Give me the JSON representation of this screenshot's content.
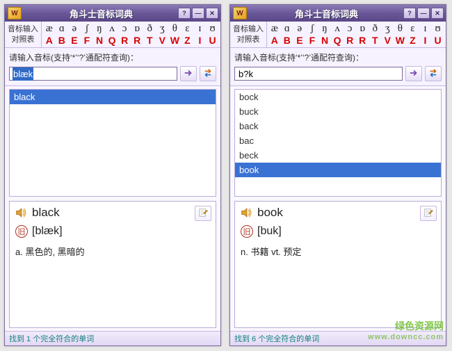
{
  "ipa_symbols": [
    "æ",
    "ɑ",
    "ə",
    "ʃ",
    "ŋ",
    "ʌ",
    "ɔ",
    "ɒ",
    "ð",
    "ʒ",
    "θ",
    "ɛ",
    "ɪ",
    "ʊ"
  ],
  "abc_letters": [
    "A",
    "B",
    "E",
    "F",
    "N",
    "Q",
    "R",
    "R",
    "T",
    "V",
    "W",
    "Z",
    "I",
    "U"
  ],
  "windows": [
    {
      "title": "角斗士音标词典",
      "ref_label1": "音标输入",
      "ref_label2": "对照表",
      "prompt": "请输入音标(支持‘*’‘?’通配符查询)：",
      "input_value": "blæk",
      "input_selected": true,
      "results": [
        "black"
      ],
      "selected_index": 0,
      "detail": {
        "word": "black",
        "badge": "旧",
        "pron": "[blæk]",
        "def": "a. 黑色的, 黑暗的"
      },
      "status": "找到 1 个完全符合的单词"
    },
    {
      "title": "角斗士音标词典",
      "ref_label1": "音标输入",
      "ref_label2": "对照表",
      "prompt": "请输入音标(支持‘*’‘?’通配符查询)：",
      "input_value": "b?k",
      "input_selected": false,
      "results": [
        "bock",
        "buck",
        "back",
        "bac",
        "beck",
        "book"
      ],
      "selected_index": 5,
      "detail": {
        "word": "book",
        "badge": "旧",
        "pron": "[buk]",
        "def": "n. 书籍  vt. 预定"
      },
      "status": "找到 6 个完全符合的单词"
    }
  ],
  "watermark": {
    "l1": "绿色资源网",
    "l2": "www.downcc.com"
  }
}
